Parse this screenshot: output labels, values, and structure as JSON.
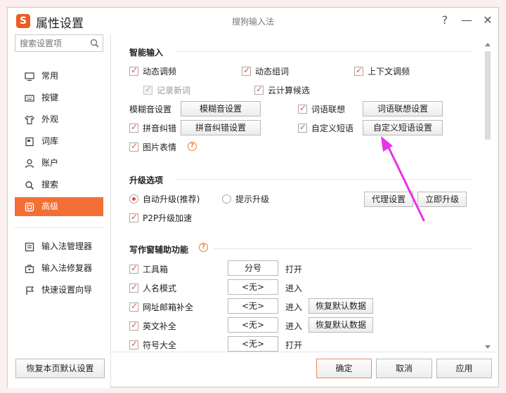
{
  "window": {
    "logo_text": "S",
    "app_title": "属性设置",
    "caption": "搜狗输入法",
    "help_glyph": "?",
    "minimize_glyph": "—",
    "close_glyph": "✕"
  },
  "sidebar": {
    "search_placeholder": "搜索设置项",
    "items": [
      {
        "label": "常用",
        "icon": "monitor-icon"
      },
      {
        "label": "按键",
        "icon": "keyboard-icon"
      },
      {
        "label": "外观",
        "icon": "shirt-icon"
      },
      {
        "label": "词库",
        "icon": "book-icon"
      },
      {
        "label": "账户",
        "icon": "user-icon"
      },
      {
        "label": "搜索",
        "icon": "search-icon"
      },
      {
        "label": "高级",
        "icon": "advanced-icon",
        "active": true
      }
    ],
    "tools": [
      {
        "label": "输入法管理器",
        "icon": "manager-icon"
      },
      {
        "label": "输入法修复器",
        "icon": "toolbox-icon"
      },
      {
        "label": "快速设置向导",
        "icon": "flag-icon"
      }
    ]
  },
  "smart": {
    "title": "智能输入",
    "dynamic_freq": "动态调频",
    "dynamic_group": "动态组词",
    "context_freq": "上下文调频",
    "record_new": "记录新词",
    "cloud": "云计算候选",
    "fuzzy_label": "模糊音设置",
    "fuzzy_button": "模糊音设置",
    "assoc": "词语联想",
    "assoc_button": "词语联想设置",
    "correction": "拼音纠错",
    "correction_button": "拼音纠错设置",
    "custom_phrase": "自定义短语",
    "custom_phrase_button": "自定义短语设置",
    "emoji": "图片表情"
  },
  "upgrade": {
    "title": "升级选项",
    "auto": "自动升级(推荐)",
    "notify": "提示升级",
    "proxy_button": "代理设置",
    "now_button": "立即升级",
    "p2p": "P2P升级加速"
  },
  "writing": {
    "title": "写作窗辅助功能",
    "rows": [
      {
        "label": "工具箱",
        "key": "分号",
        "action": "打开",
        "restore": ""
      },
      {
        "label": "人名模式",
        "key": "<无>",
        "action": "进入",
        "restore": ""
      },
      {
        "label": "网址邮箱补全",
        "key": "<无>",
        "action": "进入",
        "restore": "恢复默认数据"
      },
      {
        "label": "英文补全",
        "key": "<无>",
        "action": "进入",
        "restore": "恢复默认数据"
      },
      {
        "label": "符号大全",
        "key": "<无>",
        "action": "打开",
        "restore": ""
      }
    ]
  },
  "footer": {
    "restore_defaults": "恢复本页默认设置",
    "ok": "确定",
    "cancel": "取消",
    "apply": "应用"
  },
  "colors": {
    "accent": "#f26f35",
    "annotation_arrow": "#e832e8"
  }
}
